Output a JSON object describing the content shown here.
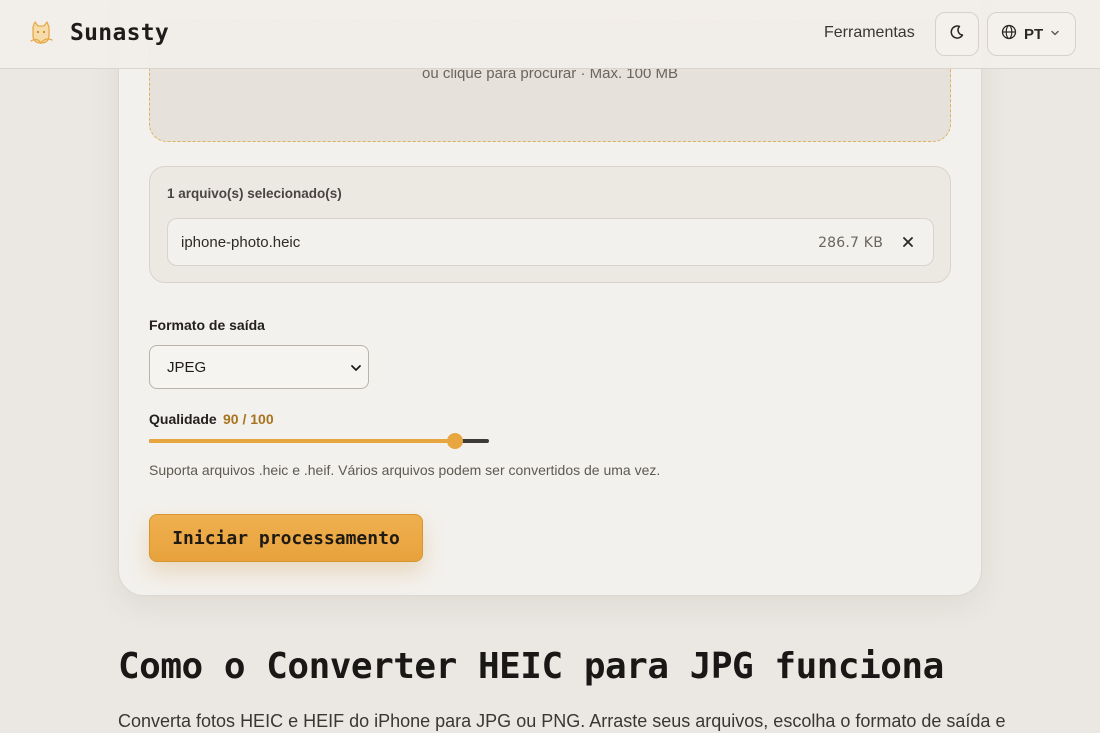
{
  "header": {
    "brand": "Sunasty",
    "nav_tools": "Ferramentas",
    "theme_icon": "moon-icon",
    "language": "PT",
    "language_icon": "globe-icon",
    "logo_icon": "cat-logo-icon"
  },
  "uploader": {
    "drop_hint": "ou clique para procurar · Máx. 100 MB"
  },
  "files": {
    "count_label": "1 arquivo(s) selecionado(s)",
    "items": [
      {
        "name": "iphone-photo.heic",
        "size": "286.7 KB"
      }
    ],
    "remove_icon": "close-icon"
  },
  "format": {
    "label": "Formato de saída",
    "selected": "JPEG"
  },
  "quality": {
    "label": "Qualidade",
    "value_text": "90 / 100",
    "value": 90,
    "max": 100
  },
  "helper_text": "Suporta arquivos .heic e .heif. Vários arquivos podem ser convertidos de uma vez.",
  "start_button": "Iniciar processamento",
  "section": {
    "title": "Como o Converter HEIC para JPG funciona",
    "text": "Converta fotos HEIC e HEIF do iPhone para JPG ou PNG. Arraste seus arquivos, escolha o formato de saída e"
  },
  "colors": {
    "accent": "#e8a640",
    "accent_text": "#a8731e",
    "background": "#ebe8e3",
    "card": "#f3f1ed"
  }
}
